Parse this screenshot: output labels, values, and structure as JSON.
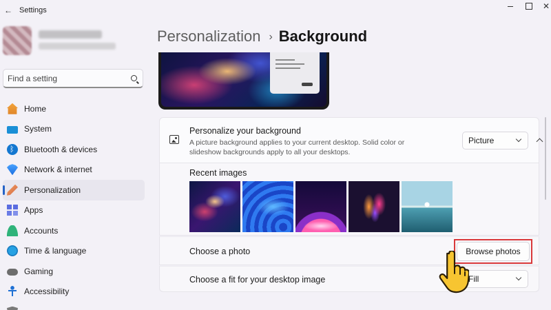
{
  "window": {
    "title": "Settings"
  },
  "search": {
    "placeholder": "Find a setting"
  },
  "sidebar": {
    "items": [
      {
        "label": "Home",
        "icon": "home-icon"
      },
      {
        "label": "System",
        "icon": "system-icon"
      },
      {
        "label": "Bluetooth & devices",
        "icon": "bluetooth-icon"
      },
      {
        "label": "Network & internet",
        "icon": "wifi-icon"
      },
      {
        "label": "Personalization",
        "icon": "brush-icon",
        "active": true
      },
      {
        "label": "Apps",
        "icon": "apps-icon"
      },
      {
        "label": "Accounts",
        "icon": "account-icon"
      },
      {
        "label": "Time & language",
        "icon": "globe-clock-icon"
      },
      {
        "label": "Gaming",
        "icon": "gamepad-icon"
      },
      {
        "label": "Accessibility",
        "icon": "accessibility-icon"
      }
    ]
  },
  "header": {
    "breadcrumb_parent": "Personalization",
    "breadcrumb_separator": "›",
    "breadcrumb_current": "Background"
  },
  "background_card": {
    "title": "Personalize your background",
    "description": "A picture background applies to your current desktop. Solid color or slideshow backgrounds apply to all your desktops.",
    "selected_type": "Picture"
  },
  "recent": {
    "label": "Recent images",
    "images": [
      "galaxy-nebula-image",
      "blue-swirl-image",
      "purple-glow-image",
      "colorful-bloom-image",
      "lake-sunrise-image"
    ]
  },
  "choose_photo": {
    "label": "Choose a photo",
    "button_label": "Browse photos"
  },
  "fit": {
    "label": "Choose a fit for your desktop image",
    "selected": "Fill"
  },
  "colors": {
    "accent": "#2563c7",
    "highlight_outline": "#d9383a",
    "background": "#f3f1f7"
  }
}
